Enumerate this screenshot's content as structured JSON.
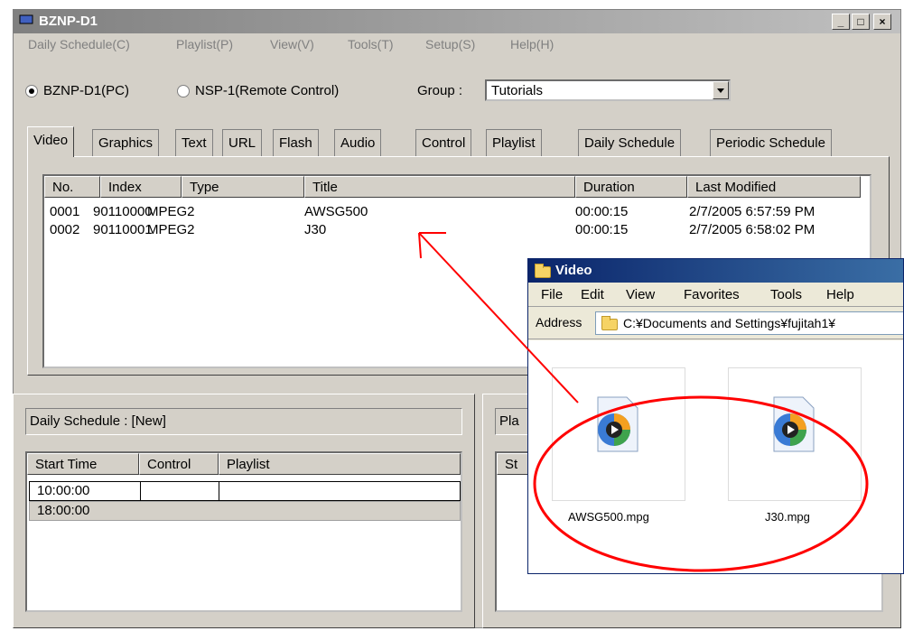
{
  "window": {
    "title": "BZNP-D1",
    "controls": [
      "_",
      "□",
      "×"
    ]
  },
  "menubar": [
    "Daily Schedule(C)",
    "Playlist(P)",
    "View(V)",
    "Tools(T)",
    "Setup(S)",
    "Help(H)"
  ],
  "mode": {
    "option_pc": "BZNP-D1(PC)",
    "option_remote": "NSP-1(Remote Control)",
    "selected": "BZNP-D1(PC)",
    "group_label": "Group :",
    "group_value": "Tutorials"
  },
  "tabs": [
    "Video",
    "Graphics",
    "Text",
    "URL",
    "Flash",
    "Audio",
    "Control",
    "Playlist",
    "Daily Schedule",
    "Periodic Schedule"
  ],
  "active_tab": "Video",
  "video_list": {
    "columns": [
      "No.",
      "Index",
      "Type",
      "Title",
      "Duration",
      "Last Modified"
    ],
    "rows": [
      {
        "no": "0001",
        "index": "90110000",
        "type": "MPEG2",
        "title": "AWSG500",
        "duration": "00:00:15",
        "modified": "2/7/2005 6:57:59 PM"
      },
      {
        "no": "0002",
        "index": "90110001",
        "type": "MPEG2",
        "title": "J30",
        "duration": "00:00:15",
        "modified": "2/7/2005 6:58:02 PM"
      }
    ]
  },
  "daily_schedule": {
    "label": "Daily Schedule : [New]",
    "columns": [
      "Start Time",
      "Control",
      "Playlist"
    ],
    "rows": [
      {
        "start": "10:00:00"
      },
      {
        "start": "18:00:00"
      }
    ]
  },
  "playlist_pane": {
    "label": "Pla",
    "column_partial": "St"
  },
  "explorer": {
    "title": "Video",
    "menu": [
      "File",
      "Edit",
      "View",
      "Favorites",
      "Tools",
      "Help"
    ],
    "address_label": "Address",
    "address_value": "C:¥Documents and Settings¥fujitah1¥",
    "files": [
      "AWSG500.mpg",
      "J30.mpg"
    ]
  },
  "colors": {
    "annotation": "#ff0000",
    "xp_title": "#0a246a",
    "classic_face": "#d4d0c8"
  }
}
